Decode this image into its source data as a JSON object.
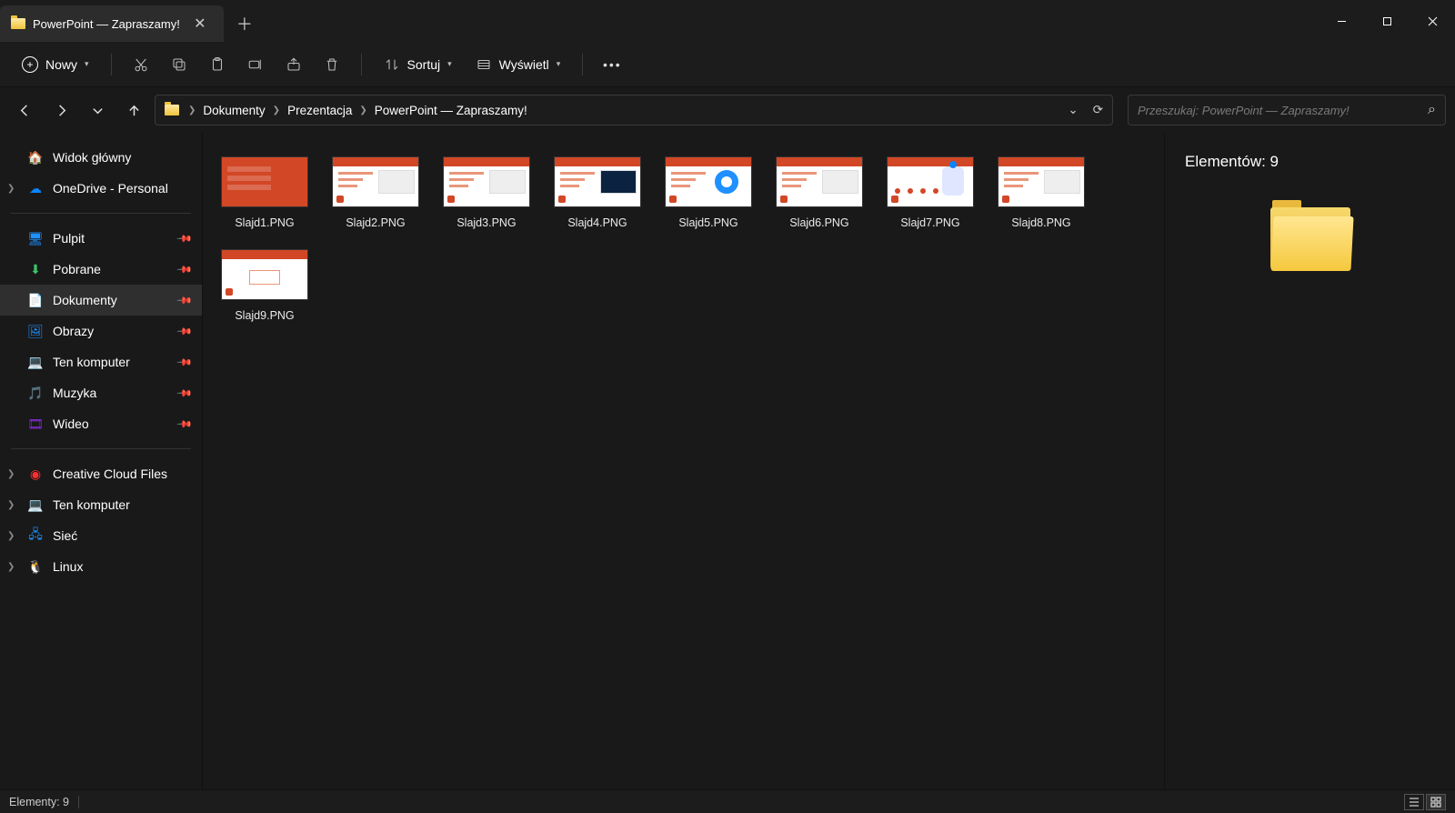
{
  "tab_title": "PowerPoint — Zapraszamy!",
  "toolbar": {
    "new_label": "Nowy",
    "sort_label": "Sortuj",
    "view_label": "Wyświetl"
  },
  "breadcrumb": [
    "Dokumenty",
    "Prezentacja",
    "PowerPoint — Zapraszamy!"
  ],
  "search_placeholder": "Przeszukaj: PowerPoint — Zapraszamy!",
  "sidebar": {
    "home": "Widok główny",
    "onedrive": "OneDrive - Personal",
    "quick": [
      {
        "label": "Pulpit"
      },
      {
        "label": "Pobrane"
      },
      {
        "label": "Dokumenty",
        "active": true
      },
      {
        "label": "Obrazy"
      },
      {
        "label": "Ten komputer"
      },
      {
        "label": "Muzyka"
      },
      {
        "label": "Wideo"
      }
    ],
    "other": [
      {
        "label": "Creative Cloud Files"
      },
      {
        "label": "Ten komputer"
      },
      {
        "label": "Sieć"
      },
      {
        "label": "Linux"
      }
    ]
  },
  "files": [
    {
      "name": "Slajd1.PNG",
      "variant": "orange"
    },
    {
      "name": "Slajd2.PNG",
      "variant": "panel"
    },
    {
      "name": "Slajd3.PNG",
      "variant": "panel"
    },
    {
      "name": "Slajd4.PNG",
      "variant": "dark"
    },
    {
      "name": "Slajd5.PNG",
      "variant": "ring"
    },
    {
      "name": "Slajd6.PNG",
      "variant": "panel"
    },
    {
      "name": "Slajd7.PNG",
      "variant": "robot"
    },
    {
      "name": "Slajd8.PNG",
      "variant": "panel"
    },
    {
      "name": "Slajd9.PNG",
      "variant": "mid"
    }
  ],
  "details_title": "Elementów: 9",
  "status_text": "Elementy: 9"
}
